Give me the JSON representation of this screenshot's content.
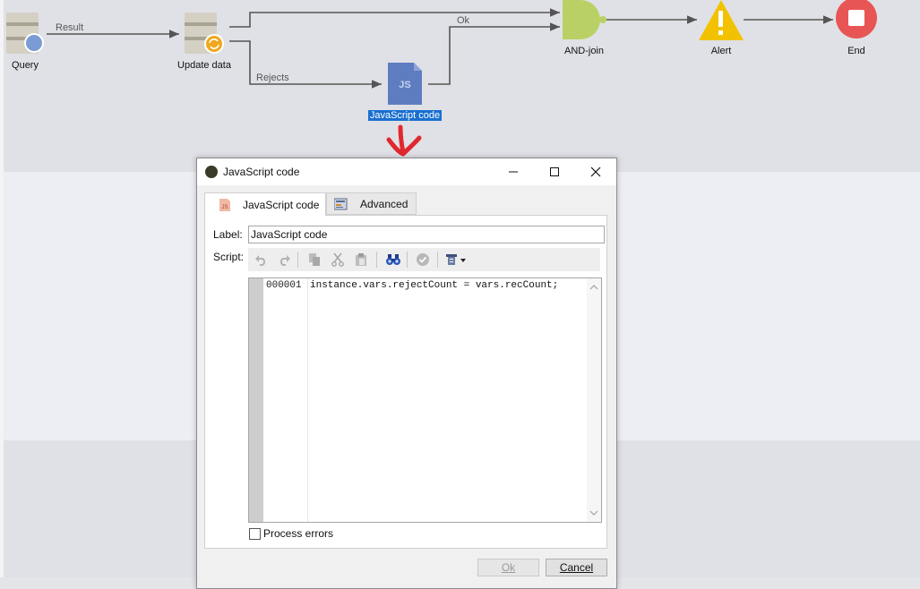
{
  "workflow": {
    "nodes": {
      "query": "Query",
      "update_data": "Update data",
      "javascript_code": "JavaScript code",
      "and_join": "AND-join",
      "alert": "Alert",
      "end": "End"
    },
    "transitions": {
      "result": "Result",
      "rejects": "Rejects",
      "ok": "Ok"
    },
    "js_icon_text": "JS"
  },
  "dialog": {
    "title": "JavaScript code",
    "tabs": [
      {
        "label": "JavaScript code",
        "icon": "js-file-icon",
        "active": true
      },
      {
        "label": "Advanced",
        "icon": "advanced-settings-icon",
        "active": false
      }
    ],
    "label_field": {
      "label": "Label:",
      "value": "JavaScript code"
    },
    "script_label": "Script:",
    "editor": {
      "line_number": "000001",
      "code": "instance.vars.rejectCount = vars.recCount;"
    },
    "process_errors_label": "Process errors",
    "buttons": {
      "ok": "Ok",
      "cancel": "Cancel"
    }
  },
  "colors": {
    "selection": "#1a6fd0",
    "and_join": "#b9d164",
    "alert": "#f2c200",
    "end": "#e85555",
    "annotation_arrow": "#e0282e"
  }
}
